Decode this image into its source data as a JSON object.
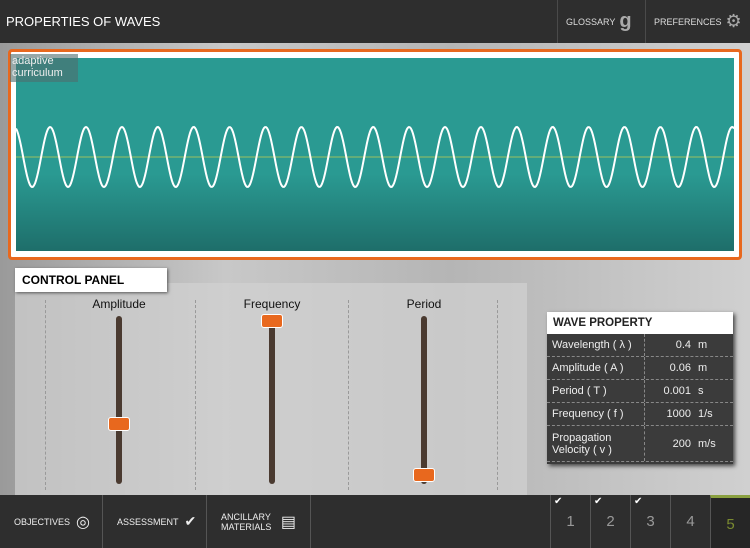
{
  "header": {
    "title": "PROPERTIES OF WAVES",
    "glossary": "GLOSSARY",
    "preferences": "PREFERENCES"
  },
  "logo": {
    "line1": "adaptive",
    "line2": "curriculum"
  },
  "wave": {
    "cycles": 20,
    "amplitude": 0.06,
    "color": "#ffffff",
    "bg": "#2a9a92"
  },
  "control_panel": {
    "title": "CONTROL PANEL",
    "sliders": [
      {
        "label": "Amplitude",
        "fraction": 0.33
      },
      {
        "label": "Frequency",
        "fraction": 1.0
      },
      {
        "label": "Period",
        "fraction": 0.0
      }
    ]
  },
  "wave_property": {
    "title": "WAVE PROPERTY",
    "rows": [
      {
        "name": "Wavelength ( λ )",
        "value": "0.4",
        "unit": "m"
      },
      {
        "name": "Amplitude ( A )",
        "value": "0.06",
        "unit": "m"
      },
      {
        "name": "Period ( T )",
        "value": "0.001",
        "unit": "s"
      },
      {
        "name": "Frequency ( f )",
        "value": "1000",
        "unit": "1/s"
      },
      {
        "name": "Propagation Velocity ( v )",
        "value": "200",
        "unit": "m/s"
      }
    ]
  },
  "footer": {
    "objectives": "OBJECTIVES",
    "assessment": "ASSESSMENT",
    "ancillary": "ANCILLARY MATERIALS",
    "steps": [
      {
        "n": "1",
        "done": true
      },
      {
        "n": "2",
        "done": true
      },
      {
        "n": "3",
        "done": true
      },
      {
        "n": "4",
        "done": false
      },
      {
        "n": "5",
        "done": false,
        "active": true
      }
    ]
  }
}
